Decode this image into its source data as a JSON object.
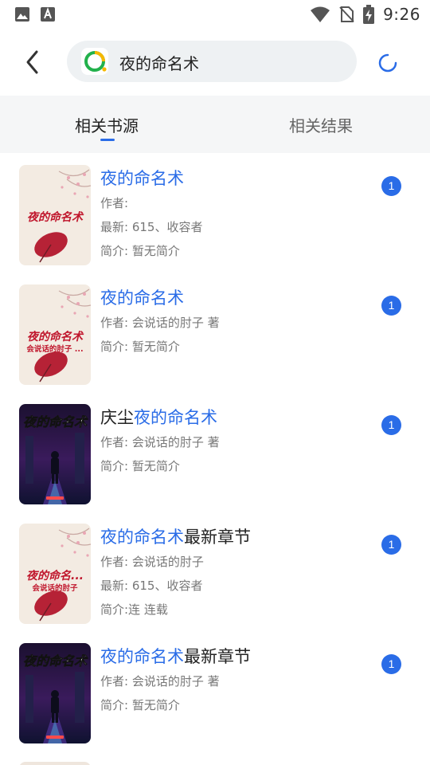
{
  "status_bar": {
    "time": "9:26",
    "left_icons": [
      "image-icon",
      "font-download-icon"
    ],
    "right_icons": [
      "wifi-icon",
      "no-sim-icon",
      "battery-charging-icon"
    ]
  },
  "header": {
    "search_value": "夜的命名术",
    "back_icon": "chevron-left-icon",
    "refresh_icon": "refresh-spinner-icon"
  },
  "tabs": [
    {
      "label": "相关书源",
      "active": true
    },
    {
      "label": "相关结果",
      "active": false
    }
  ],
  "colors": {
    "accent": "#2a6ce7",
    "tabs_bg": "#f5f6f7",
    "search_bg": "#eef1f3"
  },
  "results": [
    {
      "title_prefix": "",
      "title_hl": "夜的命名术",
      "title_suffix": "",
      "cover": "light",
      "cover_title": "夜的命名术",
      "cover_sub": "",
      "lines": [
        "作者:",
        "最新: 615、收容者",
        "简介: 暂无简介"
      ],
      "badge": "1"
    },
    {
      "title_prefix": "",
      "title_hl": "夜的命名术",
      "title_suffix": "",
      "cover": "light",
      "cover_title": "夜的命名术",
      "cover_sub": "会说话的肘子 ...",
      "lines": [
        "作者: 会说话的肘子  著",
        "简介: 暂无简介"
      ],
      "badge": "1"
    },
    {
      "title_prefix": "庆尘",
      "title_hl": "夜的命名术",
      "title_suffix": "",
      "cover": "dark",
      "cover_title": "夜的命名术",
      "cover_sub": "",
      "lines": [
        "作者: 会说话的肘子  著",
        "简介: 暂无简介"
      ],
      "badge": "1"
    },
    {
      "title_prefix": "",
      "title_hl": "夜的命名术",
      "title_suffix": "最新章节",
      "cover": "light",
      "cover_title": "夜的命名...",
      "cover_sub": "会说话的肘子",
      "lines": [
        "作者: 会说话的肘子",
        "最新: 615、收容者",
        "简介:连 连载"
      ],
      "badge": "1"
    },
    {
      "title_prefix": "",
      "title_hl": "夜的命名术",
      "title_suffix": "最新章节",
      "cover": "dark",
      "cover_title": "夜的命名术",
      "cover_sub": "",
      "lines": [
        "作者: 会说话的肘子  著",
        "简介: 暂无简介"
      ],
      "badge": "1"
    }
  ]
}
